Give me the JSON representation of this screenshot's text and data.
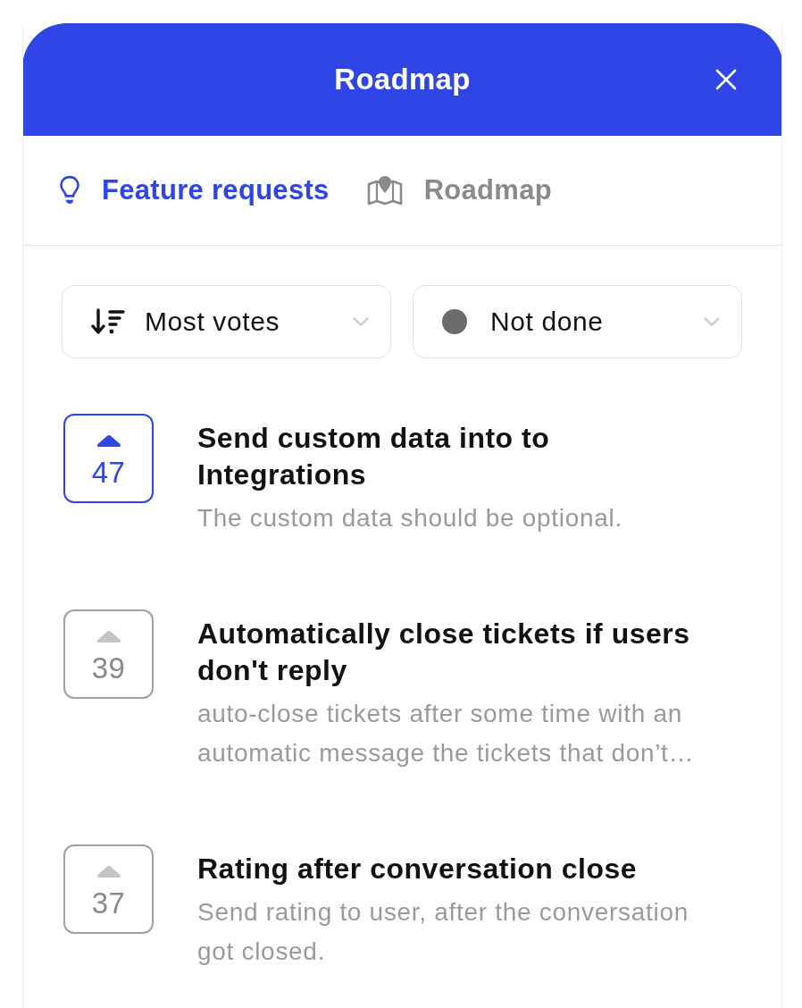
{
  "header": {
    "title": "Roadmap"
  },
  "tabs": [
    {
      "kind": "ideas",
      "label": "Feature requests",
      "selected": true
    },
    {
      "kind": "roadmap",
      "label": "Roadmap",
      "selected": false
    }
  ],
  "filters": [
    {
      "kind": "sort",
      "label": "Most votes"
    },
    {
      "kind": "status",
      "label": "Not done",
      "color": "#6b6b6b"
    }
  ],
  "requests": [
    {
      "votes": "47",
      "voted": true,
      "title": "Send custom data into to Integrations",
      "description": "The custom data should be optional."
    },
    {
      "votes": "39",
      "voted": false,
      "title": "Automatically close tickets if users don't reply",
      "description": "auto-close tickets after some time with an automatic message the tickets that don’t…"
    },
    {
      "votes": "37",
      "voted": false,
      "title": "Rating after conversation close",
      "description": "Send rating to user, after the conversation got closed."
    }
  ]
}
